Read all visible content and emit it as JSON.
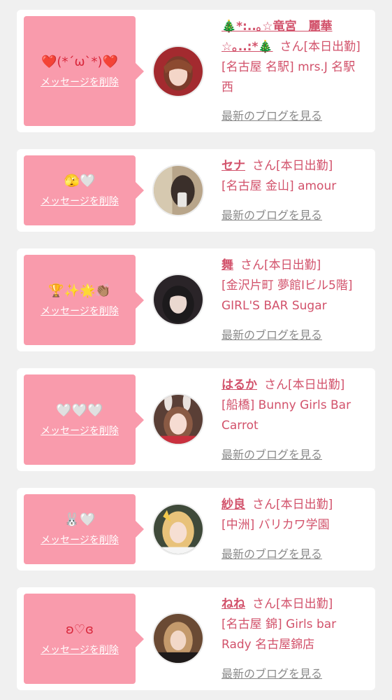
{
  "delete_label": "メッセージを削除",
  "blog_label": "最新のブログを見る",
  "status_suffix": "さん[本日出勤]",
  "colors": {
    "accent": "#d2526b",
    "bubble": "#f99bac",
    "background": "#f0f0f0",
    "card": "#ffffff"
  },
  "messages": [
    {
      "emoji": "❤️(*´ω`*)❤️",
      "name": "🎄*:..｡☆竜宮　麗華☆｡..:*🎄",
      "shop": "[名古屋 名駅] mrs.J 名駅西",
      "avatar_icon": "avatar-photo-icon"
    },
    {
      "emoji": "🫣🤍",
      "name": "セナ",
      "shop": "[名古屋 金山] amour",
      "avatar_icon": "avatar-photo-icon"
    },
    {
      "emoji": "🏆✨🌟👏🏽",
      "name": "舞",
      "shop": "[金沢片町 夢館Ⅰビル5階] GIRL'S BAR Sugar",
      "avatar_icon": "avatar-photo-icon"
    },
    {
      "emoji": "🤍🤍🤍",
      "name": "はるか",
      "shop": "[船橋] Bunny Girls Bar Carrot",
      "avatar_icon": "avatar-photo-icon"
    },
    {
      "emoji": "🐰🤍",
      "name": "紗良",
      "shop": "[中洲] バリカワ学園",
      "avatar_icon": "avatar-photo-icon"
    },
    {
      "emoji": "ʚ♡ɞ",
      "name": "ねね",
      "shop": "[名古屋 錦] Girls bar Rady 名古屋錦店",
      "avatar_icon": "avatar-photo-icon"
    }
  ]
}
